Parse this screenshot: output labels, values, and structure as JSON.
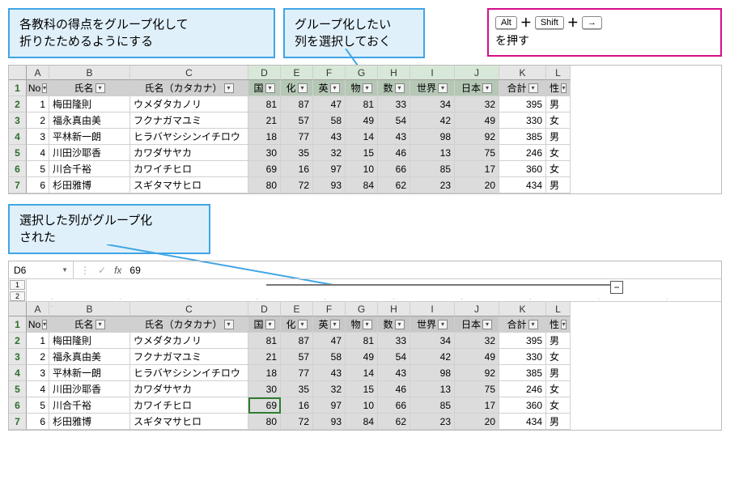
{
  "callouts": {
    "c1_l1": "各教科の得点をグループ化して",
    "c1_l2": "折りたためるようにする",
    "c2_l1": "グループ化したい",
    "c2_l2": "列を選択しておく",
    "c3_l1": "選択した列がグループ化",
    "c3_l2": "された"
  },
  "shortcut": {
    "key1": "Alt",
    "key2": "Shift",
    "key3": "→",
    "suffix": "を押す"
  },
  "columns": {
    "labels": [
      "A",
      "B",
      "C",
      "D",
      "E",
      "F",
      "G",
      "H",
      "I",
      "J",
      "K",
      "L"
    ],
    "selected": [
      "D",
      "E",
      "F",
      "G",
      "H",
      "I",
      "J"
    ]
  },
  "headers": {
    "no": "No",
    "name": "氏名",
    "kana": "氏名（カタカナ）",
    "subj": [
      "国",
      "化",
      "英",
      "物",
      "数",
      "世界",
      "日本"
    ],
    "total": "合計",
    "gender": "性"
  },
  "rows": [
    {
      "no": 1,
      "name": "梅田隆則",
      "kana": "ウメダタカノリ",
      "s": [
        81,
        87,
        47,
        81,
        33,
        34,
        32
      ],
      "total": 395,
      "g": "男"
    },
    {
      "no": 2,
      "name": "福永真由美",
      "kana": "フクナガマユミ",
      "s": [
        21,
        57,
        58,
        49,
        54,
        42,
        49
      ],
      "total": 330,
      "g": "女"
    },
    {
      "no": 3,
      "name": "平林新一朗",
      "kana": "ヒラバヤシシンイチロウ",
      "s": [
        18,
        77,
        43,
        14,
        43,
        98,
        92
      ],
      "total": 385,
      "g": "男"
    },
    {
      "no": 4,
      "name": "川田沙耶香",
      "kana": "カワダサヤカ",
      "s": [
        30,
        35,
        32,
        15,
        46,
        13,
        75
      ],
      "total": 246,
      "g": "女"
    },
    {
      "no": 5,
      "name": "川合千裕",
      "kana": "カワイチヒロ",
      "s": [
        69,
        16,
        97,
        10,
        66,
        85,
        17
      ],
      "total": 360,
      "g": "女"
    },
    {
      "no": 6,
      "name": "杉田雅博",
      "kana": "スギタマサヒロ",
      "s": [
        80,
        72,
        93,
        84,
        62,
        23,
        20
      ],
      "total": 434,
      "g": "男"
    }
  ],
  "formula_bar": {
    "cell_ref": "D6",
    "value": "69"
  },
  "outline": {
    "levels": [
      "1",
      "2"
    ],
    "button": "−"
  }
}
